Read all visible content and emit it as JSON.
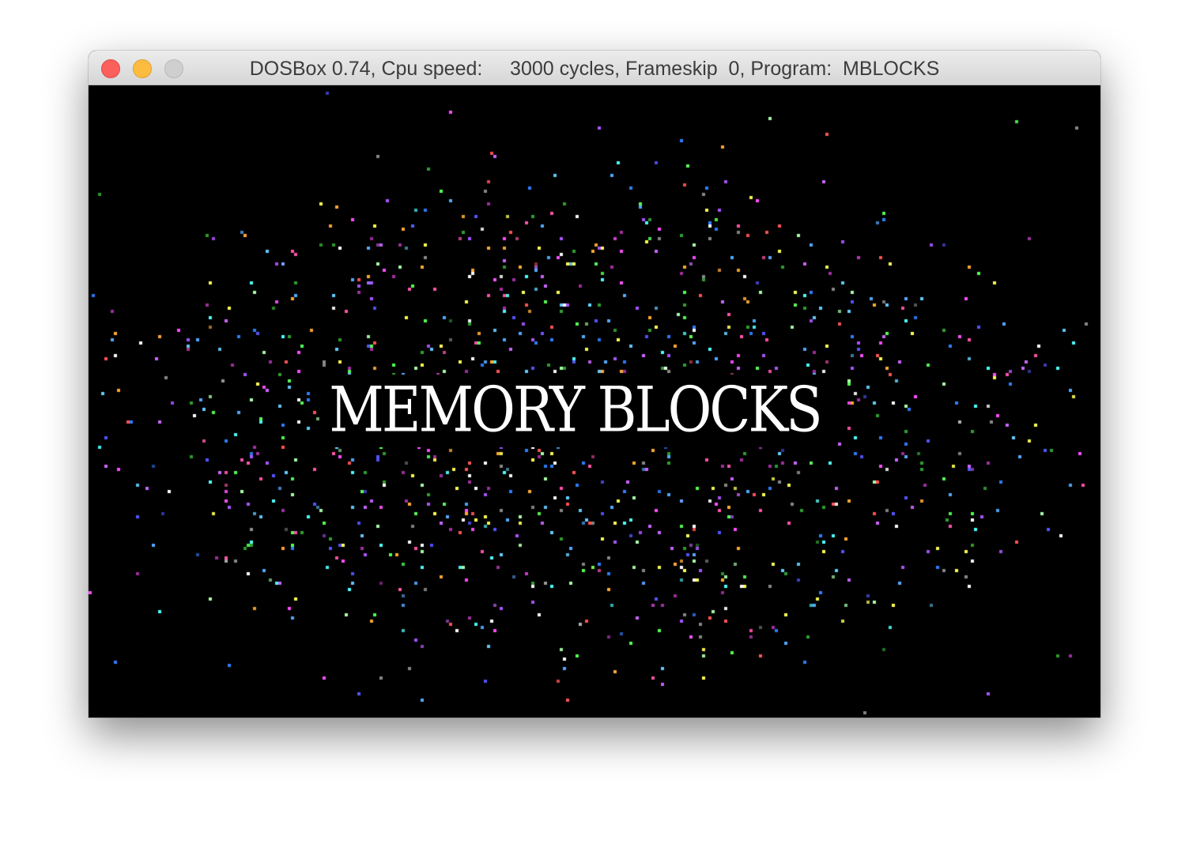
{
  "window": {
    "title": "DOSBox 0.74, Cpu speed:     3000 cycles, Frameskip  0, Program:  MBLOCKS",
    "controls": {
      "close": "close-icon",
      "minimize": "minimize-icon",
      "zoom": "zoom-icon"
    }
  },
  "game": {
    "title": "MEMORY BLOCKS",
    "background_color": "#000000",
    "title_color": "#ffffff"
  }
}
